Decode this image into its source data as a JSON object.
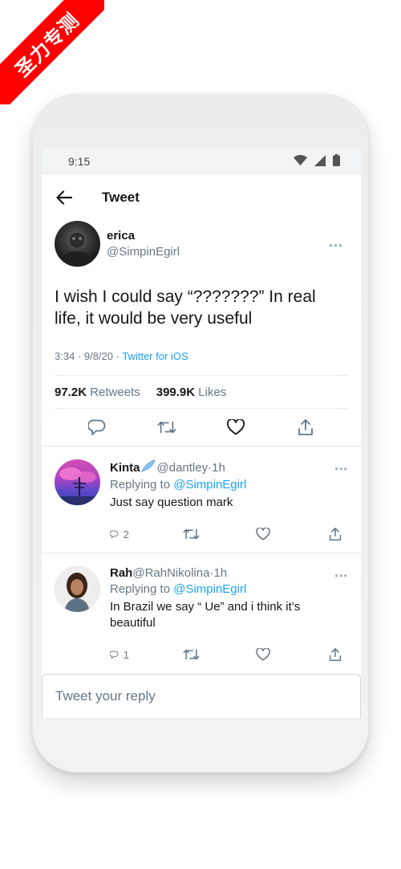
{
  "banner": {
    "text": "圣力专测"
  },
  "status_bar": {
    "time": "9:15"
  },
  "header": {
    "title": "Tweet"
  },
  "tweet": {
    "author_name": "erica",
    "author_handle": "@SimpinEgirl",
    "text": "I wish I could say “???????” In real life, it would be very useful",
    "time": "3:34 · 9/8/20 · ",
    "source": "Twitter for iOS",
    "retweets_count": "97.2K",
    "retweets_label": "Retweets",
    "likes_count": "399.9K",
    "likes_label": "Likes"
  },
  "replies": [
    {
      "name": "Kinta",
      "handle": "@dantley",
      "time": "1h",
      "replying_prefix": "Replying to ",
      "replying_to": "@SimpinEgirl",
      "text": "Just say question mark",
      "reply_count": "2"
    },
    {
      "name": "Rah",
      "handle": "@RahNikolina",
      "time": "1h",
      "replying_prefix": "Replying to ",
      "replying_to": "@SimpinEgirl",
      "text": "In Brazil we say “ Ue” and i think it’s beautiful",
      "reply_count": "1"
    }
  ],
  "compose": {
    "placeholder": "Tweet your reply"
  },
  "colors": {
    "accent": "#1da1f2",
    "ribbon": "#ff0000",
    "text": "#14171a",
    "muted": "#657786"
  }
}
